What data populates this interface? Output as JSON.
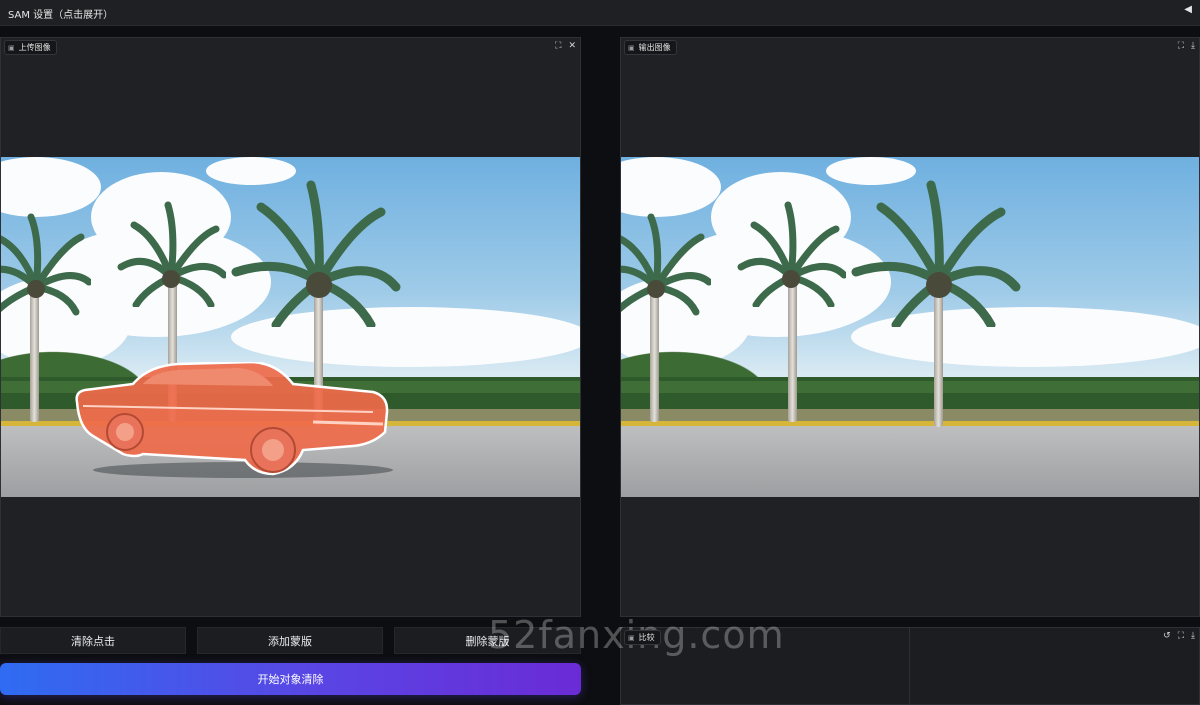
{
  "app": {
    "settings_title": "SAM 设置（点击展开）",
    "collapse_glyph": "◀"
  },
  "input_panel": {
    "label": "上传图像",
    "label_icon": "image-icon",
    "fullscreen_glyph": "⛶",
    "close_glyph": "✕"
  },
  "output_panel": {
    "label": "输出图像",
    "label_icon": "image-icon",
    "fullscreen_glyph": "⛶",
    "download_glyph": "⤓"
  },
  "buttons": {
    "clear_clicks": "清除点击",
    "add_mask": "添加蒙版",
    "delete_mask": "删除蒙版",
    "start_removal": "开始对象清除"
  },
  "compare_panel": {
    "label": "比较",
    "reset_glyph": "↺",
    "fullscreen_glyph": "⛶",
    "download_glyph": "⤓"
  },
  "watermark": "52fanxing.com",
  "colors": {
    "mask_overlay": "#ef6a4a",
    "primary_gradient_start": "#2f6cf2",
    "primary_gradient_end": "#6a2bd6",
    "panel_bg": "#202124",
    "page_bg": "#0d0e11"
  }
}
